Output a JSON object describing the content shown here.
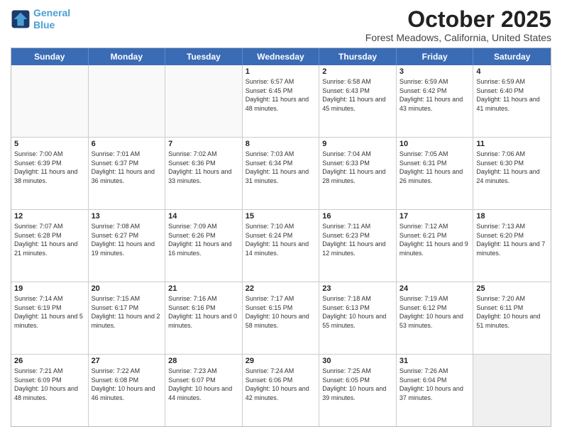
{
  "header": {
    "logo_line1": "General",
    "logo_line2": "Blue",
    "month": "October 2025",
    "location": "Forest Meadows, California, United States"
  },
  "days_of_week": [
    "Sunday",
    "Monday",
    "Tuesday",
    "Wednesday",
    "Thursday",
    "Friday",
    "Saturday"
  ],
  "weeks": [
    [
      {
        "day": "",
        "info": ""
      },
      {
        "day": "",
        "info": ""
      },
      {
        "day": "",
        "info": ""
      },
      {
        "day": "1",
        "info": "Sunrise: 6:57 AM\nSunset: 6:45 PM\nDaylight: 11 hours and 48 minutes."
      },
      {
        "day": "2",
        "info": "Sunrise: 6:58 AM\nSunset: 6:43 PM\nDaylight: 11 hours and 45 minutes."
      },
      {
        "day": "3",
        "info": "Sunrise: 6:59 AM\nSunset: 6:42 PM\nDaylight: 11 hours and 43 minutes."
      },
      {
        "day": "4",
        "info": "Sunrise: 6:59 AM\nSunset: 6:40 PM\nDaylight: 11 hours and 41 minutes."
      }
    ],
    [
      {
        "day": "5",
        "info": "Sunrise: 7:00 AM\nSunset: 6:39 PM\nDaylight: 11 hours and 38 minutes."
      },
      {
        "day": "6",
        "info": "Sunrise: 7:01 AM\nSunset: 6:37 PM\nDaylight: 11 hours and 36 minutes."
      },
      {
        "day": "7",
        "info": "Sunrise: 7:02 AM\nSunset: 6:36 PM\nDaylight: 11 hours and 33 minutes."
      },
      {
        "day": "8",
        "info": "Sunrise: 7:03 AM\nSunset: 6:34 PM\nDaylight: 11 hours and 31 minutes."
      },
      {
        "day": "9",
        "info": "Sunrise: 7:04 AM\nSunset: 6:33 PM\nDaylight: 11 hours and 28 minutes."
      },
      {
        "day": "10",
        "info": "Sunrise: 7:05 AM\nSunset: 6:31 PM\nDaylight: 11 hours and 26 minutes."
      },
      {
        "day": "11",
        "info": "Sunrise: 7:06 AM\nSunset: 6:30 PM\nDaylight: 11 hours and 24 minutes."
      }
    ],
    [
      {
        "day": "12",
        "info": "Sunrise: 7:07 AM\nSunset: 6:28 PM\nDaylight: 11 hours and 21 minutes."
      },
      {
        "day": "13",
        "info": "Sunrise: 7:08 AM\nSunset: 6:27 PM\nDaylight: 11 hours and 19 minutes."
      },
      {
        "day": "14",
        "info": "Sunrise: 7:09 AM\nSunset: 6:26 PM\nDaylight: 11 hours and 16 minutes."
      },
      {
        "day": "15",
        "info": "Sunrise: 7:10 AM\nSunset: 6:24 PM\nDaylight: 11 hours and 14 minutes."
      },
      {
        "day": "16",
        "info": "Sunrise: 7:11 AM\nSunset: 6:23 PM\nDaylight: 11 hours and 12 minutes."
      },
      {
        "day": "17",
        "info": "Sunrise: 7:12 AM\nSunset: 6:21 PM\nDaylight: 11 hours and 9 minutes."
      },
      {
        "day": "18",
        "info": "Sunrise: 7:13 AM\nSunset: 6:20 PM\nDaylight: 11 hours and 7 minutes."
      }
    ],
    [
      {
        "day": "19",
        "info": "Sunrise: 7:14 AM\nSunset: 6:19 PM\nDaylight: 11 hours and 5 minutes."
      },
      {
        "day": "20",
        "info": "Sunrise: 7:15 AM\nSunset: 6:17 PM\nDaylight: 11 hours and 2 minutes."
      },
      {
        "day": "21",
        "info": "Sunrise: 7:16 AM\nSunset: 6:16 PM\nDaylight: 11 hours and 0 minutes."
      },
      {
        "day": "22",
        "info": "Sunrise: 7:17 AM\nSunset: 6:15 PM\nDaylight: 10 hours and 58 minutes."
      },
      {
        "day": "23",
        "info": "Sunrise: 7:18 AM\nSunset: 6:13 PM\nDaylight: 10 hours and 55 minutes."
      },
      {
        "day": "24",
        "info": "Sunrise: 7:19 AM\nSunset: 6:12 PM\nDaylight: 10 hours and 53 minutes."
      },
      {
        "day": "25",
        "info": "Sunrise: 7:20 AM\nSunset: 6:11 PM\nDaylight: 10 hours and 51 minutes."
      }
    ],
    [
      {
        "day": "26",
        "info": "Sunrise: 7:21 AM\nSunset: 6:09 PM\nDaylight: 10 hours and 48 minutes."
      },
      {
        "day": "27",
        "info": "Sunrise: 7:22 AM\nSunset: 6:08 PM\nDaylight: 10 hours and 46 minutes."
      },
      {
        "day": "28",
        "info": "Sunrise: 7:23 AM\nSunset: 6:07 PM\nDaylight: 10 hours and 44 minutes."
      },
      {
        "day": "29",
        "info": "Sunrise: 7:24 AM\nSunset: 6:06 PM\nDaylight: 10 hours and 42 minutes."
      },
      {
        "day": "30",
        "info": "Sunrise: 7:25 AM\nSunset: 6:05 PM\nDaylight: 10 hours and 39 minutes."
      },
      {
        "day": "31",
        "info": "Sunrise: 7:26 AM\nSunset: 6:04 PM\nDaylight: 10 hours and 37 minutes."
      },
      {
        "day": "",
        "info": ""
      }
    ]
  ]
}
